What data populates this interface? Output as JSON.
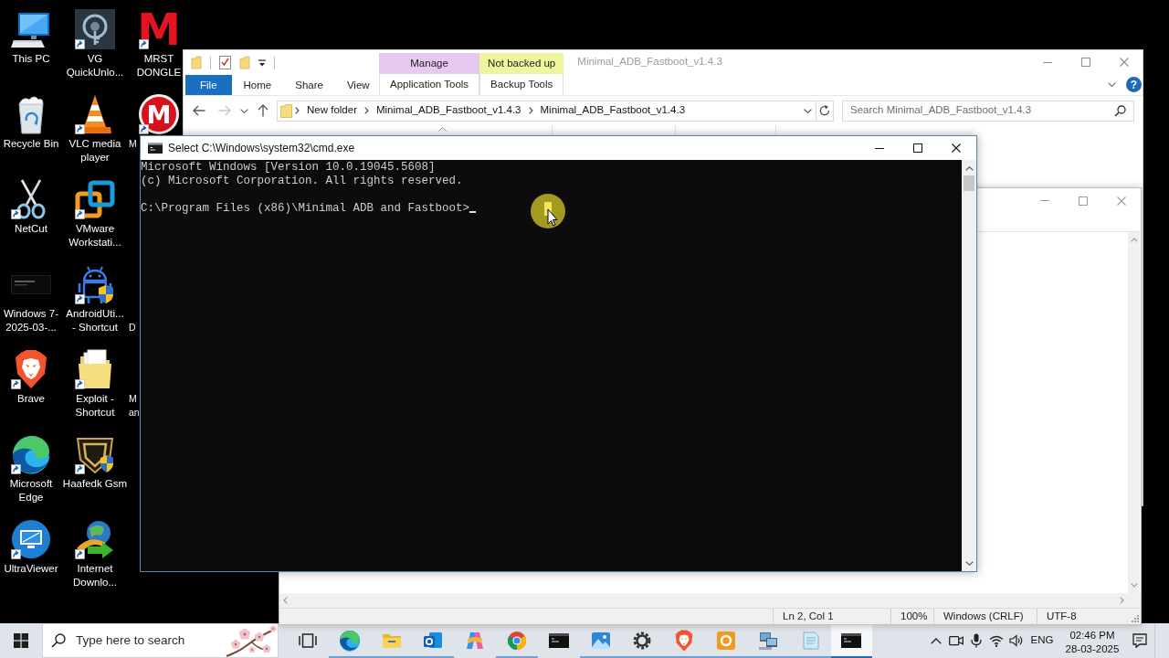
{
  "desktop": {
    "icon_columns": [
      [
        {
          "label": "This PC",
          "shortcut": false
        },
        {
          "label": "Recycle Bin",
          "shortcut": false
        },
        {
          "label": "NetCut",
          "shortcut": true
        },
        {
          "label": "Windows 7-2025-03-...",
          "shortcut": false
        },
        {
          "label": "Brave",
          "shortcut": true
        },
        {
          "label": "Microsoft Edge",
          "shortcut": true
        },
        {
          "label": "UltraViewer",
          "shortcut": true
        }
      ],
      [
        {
          "label": "VG QuickUnlo...",
          "shortcut": true
        },
        {
          "label": "VLC media player",
          "shortcut": true
        },
        {
          "label": "VMware Workstati...",
          "shortcut": true
        },
        {
          "label": "AndroidUti... - Shortcut",
          "shortcut": true
        },
        {
          "label": "Exploit - Shortcut",
          "shortcut": true
        },
        {
          "label": "Haafedk Gsm",
          "shortcut": true
        },
        {
          "label": "Internet Downlo...",
          "shortcut": true
        }
      ],
      [
        {
          "label": "MRST DONGLE",
          "logo": "M",
          "shortcut": true
        },
        {
          "label": "M",
          "logo": "M",
          "shortcut": true
        },
        {
          "label": "D"
        },
        {
          "label": "M an"
        }
      ]
    ]
  },
  "explorer": {
    "title": "Minimal_ADB_Fastboot_v1.4.3",
    "tabs": [
      {
        "label": "File",
        "kind": "file",
        "selected": false
      },
      {
        "label": "Home",
        "kind": "tab",
        "selected": false
      },
      {
        "label": "Share",
        "kind": "tab",
        "selected": false
      },
      {
        "label": "View",
        "kind": "tab",
        "selected": false
      }
    ],
    "context_groups": [
      {
        "label": "Manage",
        "color": "#e6c8f1",
        "tab": {
          "label": "Application Tools",
          "selected": false
        }
      },
      {
        "label": "Not backed up",
        "color": "#eef59c",
        "tab": {
          "label": "Backup Tools",
          "selected": false
        }
      }
    ],
    "help": "?",
    "nav_buttons": [
      {
        "disabled": false
      },
      {
        "disabled": true
      },
      {
        "disabled": false
      },
      {
        "disabled": false
      }
    ],
    "breadcrumb": [
      "New folder",
      "Minimal_ADB_Fastboot_v1.4.3",
      "Minimal_ADB_Fastboot_v1.4.3"
    ],
    "search": {
      "placeholder": "Search Minimal_ADB_Fastboot_v1.4.3"
    }
  },
  "cmd": {
    "title": "Select C:\\Windows\\system32\\cmd.exe",
    "lines": [
      "Microsoft Windows [Version 10.0.19045.5608]",
      "(c) Microsoft Corporation. All rights reserved."
    ],
    "prompt": "C:\\Program Files (x86)\\Minimal ADB and Fastboot>"
  },
  "notepad": {
    "status_bar": [
      "Ln 2, Col 1",
      "100%",
      "Windows (CRLF)",
      "UTF-8"
    ]
  },
  "taskbar": {
    "search": {
      "placeholder": "Type here to search"
    },
    "apps": [
      {
        "running": true,
        "selected": false
      },
      {
        "running": true,
        "selected": false
      },
      {
        "running": true,
        "selected": false
      },
      {
        "running": false,
        "selected": false
      },
      {
        "running": true,
        "selected": false
      },
      {
        "running": false,
        "selected": false
      },
      {
        "running": true,
        "selected": false
      },
      {
        "running": true,
        "selected": false
      },
      {
        "running": true,
        "selected": false
      },
      {
        "running": true,
        "selected": false
      },
      {
        "running": true,
        "selected": false
      },
      {
        "running": true,
        "selected": false
      },
      {
        "running": true,
        "selected": true
      }
    ],
    "tray": {
      "language": "ENG",
      "time": "02:46 PM",
      "date": "28-03-2025"
    }
  }
}
